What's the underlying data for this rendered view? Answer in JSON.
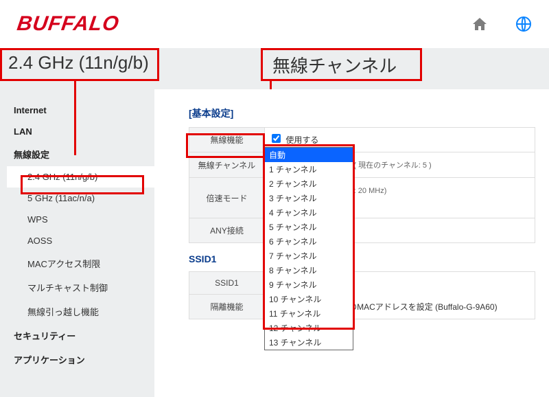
{
  "brand": "BUFFALO",
  "title_left": "2.4 GHz (11n/g/b)",
  "title_right": "無線チャンネル",
  "sidebar": {
    "groups": [
      {
        "label": "Internet"
      },
      {
        "label": "LAN"
      },
      {
        "label": "無線設定",
        "items": [
          {
            "label": "2.4 GHz (11n/g/b)",
            "active": true
          },
          {
            "label": "5 GHz (11ac/n/a)"
          },
          {
            "label": "WPS"
          },
          {
            "label": "AOSS"
          },
          {
            "label": "MACアクセス制限"
          },
          {
            "label": "マルチキャスト制御"
          },
          {
            "label": "無線引っ越し機能"
          }
        ]
      },
      {
        "label": "セキュリティー"
      },
      {
        "label": "アプリケーション"
      }
    ]
  },
  "section_basic": "[基本設定]",
  "rows": {
    "wireless": {
      "label": "無線機能",
      "checkbox_label": "使用する",
      "checked": true
    },
    "channel": {
      "label": "無線チャンネル",
      "selected": "自動",
      "note": "( 現在のチャンネル: 5 )",
      "options": [
        "自動",
        "1 チャンネル",
        "2 チャンネル",
        "3 チャンネル",
        "4 チャンネル",
        "5 チャンネル",
        "6 チャンネル",
        "7 チャンネル",
        "8 チャンネル",
        "9 チャンネル",
        "10 チャンネル",
        "11 チャンネル",
        "12 チャンネル",
        "13 チャンネル"
      ]
    },
    "speed": {
      "label": "倍速モード",
      "value": "20 MHz",
      "note": "(Current: 20 MHz)"
    },
    "any": {
      "label": "ANY接続"
    }
  },
  "section_ssid": "SSID1",
  "ssid_rows": {
    "ssid": {
      "label": "SSID1"
    },
    "isolation": {
      "label": "隔離機能"
    },
    "mac_note": "エアステーションのMACアドレスを設定 (Buffalo-G-9A60)"
  }
}
